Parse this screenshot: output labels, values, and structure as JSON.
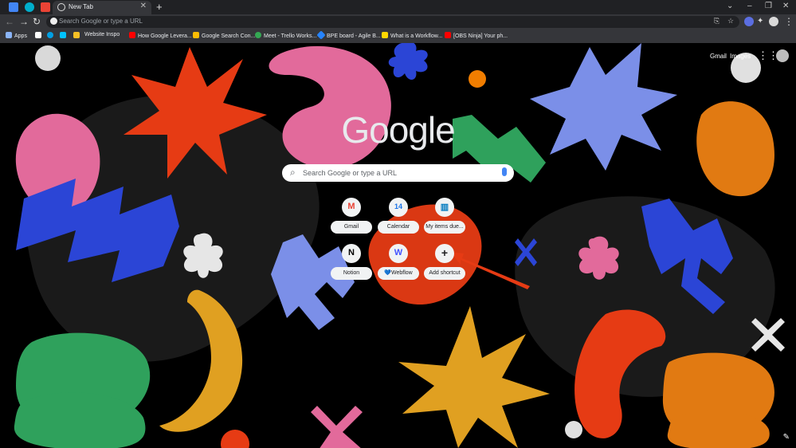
{
  "tab": {
    "title": "New Tab",
    "close": "✕"
  },
  "tabstrip": {
    "new_tab": "+",
    "chevron": "⌄",
    "minimize": "–",
    "restore": "❐",
    "close": "✕"
  },
  "toolbar": {
    "back": "←",
    "forward": "→",
    "reload": "↻",
    "placeholder": "Search Google or type a URL",
    "share": "⎘",
    "bookmark": "☆",
    "extensions": "✦",
    "menu": "⋮"
  },
  "bookmarks": [
    {
      "label": "Apps",
      "color": "#8ab4f8"
    },
    {
      "label": "",
      "color": "#ffffff"
    },
    {
      "label": "",
      "color": "#00a0e4"
    },
    {
      "label": "",
      "color": "#00c2ff"
    },
    {
      "label": "",
      "color": "#f6c026"
    },
    {
      "label": "Website Inspo",
      "color": "#f6c026"
    },
    {
      "label": "How Google Levera...",
      "color": "#ff0000"
    },
    {
      "label": "Google Search Con...",
      "color": "#fbbc04"
    },
    {
      "label": "Meet - Trello Works...",
      "color": "#34a853"
    },
    {
      "label": "BPE board - Agile B...",
      "color": "#2684ff"
    },
    {
      "label": "What is a Workflow...",
      "color": "#ffd700"
    },
    {
      "label": "[OBS Ninja] Your ph...",
      "color": "#ff0000"
    }
  ],
  "header": {
    "gmail": "Gmail",
    "images": "Images"
  },
  "logo": "Google",
  "search": {
    "placeholder": "Search Google or type a URL"
  },
  "shortcuts": [
    {
      "label": "Gmail",
      "glyph": "M",
      "color": "#ea4335"
    },
    {
      "label": "Calendar",
      "glyph": "14",
      "color": "#1a73e8"
    },
    {
      "label": "My items due...",
      "glyph": "▥",
      "color": "#0079bf"
    },
    {
      "label": "Notion",
      "glyph": "N",
      "color": "#000000"
    },
    {
      "label": "💙Webflow",
      "glyph": "W",
      "color": "#4353ff"
    },
    {
      "label": "Add shortcut",
      "glyph": "+",
      "color": "#202124"
    }
  ],
  "colors": {
    "red": "#e63b14",
    "pink": "#e26a9b",
    "blue": "#2b45d6",
    "periwinkle": "#7b8fe8",
    "orange": "#e17a12",
    "green": "#2fa15c",
    "mustard": "#e0a021"
  }
}
